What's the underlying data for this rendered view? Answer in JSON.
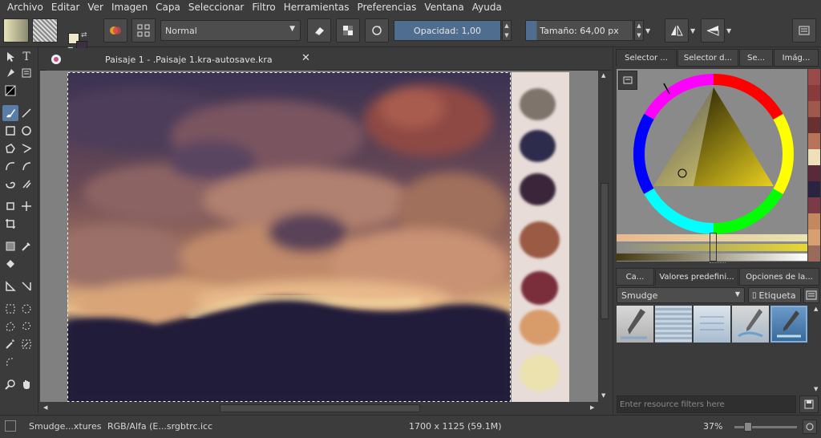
{
  "menubar": {
    "items": [
      {
        "label": "Archivo",
        "key": "A"
      },
      {
        "label": "Editar",
        "key": "E"
      },
      {
        "label": "Ver",
        "key": "V"
      },
      {
        "label": "Imagen",
        "key": "I"
      },
      {
        "label": "Capa",
        "key": "C"
      },
      {
        "label": "Seleccionar",
        "key": "S"
      },
      {
        "label": "Filtro",
        "key": "F"
      },
      {
        "label": "Herramientas",
        "key": "H"
      },
      {
        "label": "Preferencias",
        "key": "P"
      },
      {
        "label": "Ventana",
        "key": "V"
      },
      {
        "label": "Ayuda",
        "key": "A"
      }
    ]
  },
  "toolbar": {
    "blend_mode": "Normal",
    "opacity_label": "Opacidad:",
    "opacity_value": "1,00",
    "size_label": "Tamaño:",
    "size_value": "64,00 px"
  },
  "document": {
    "tab_title": "Paisaje 1 - .Paisaje 1.kra-autosave.kra"
  },
  "palette_swatches": [
    "#7f746c",
    "#2e2c4c",
    "#3a253a",
    "#9a5a44",
    "#7a2e3c",
    "#d89c6a",
    "#ece2b0"
  ],
  "right_dock": {
    "top_tabs": [
      "Selector ...",
      "Selector d...",
      "Se...",
      "Imág..."
    ],
    "bottom_tabs": [
      "Ca...",
      "Valores predefini...",
      "Opciones de la..."
    ],
    "brush_category": "Smudge",
    "tag_label": "Etiqueta",
    "filter_placeholder": "Enter resource filters here",
    "history_colors": [
      "#9a4a4a",
      "#8a3a3a",
      "#a0584a",
      "#6a3030",
      "#b8745a",
      "#eee0b8",
      "#5a2a3a",
      "#2a2440",
      "#7a3a46",
      "#c4885e",
      "#d8a070",
      "#9a6a5a"
    ]
  },
  "statusbar": {
    "brush_name": "Smudge...xtures",
    "color_profile": "RGB/Alfa (E...srgbtrc.icc",
    "dimensions": "1700 x 1125 (59.1M)",
    "zoom": "37%"
  },
  "colors": {
    "accent": "#5a7da8",
    "slider_fill": "#4f6d8f",
    "fg_color": "#efe9c9",
    "bg_color": "#3a3040"
  }
}
